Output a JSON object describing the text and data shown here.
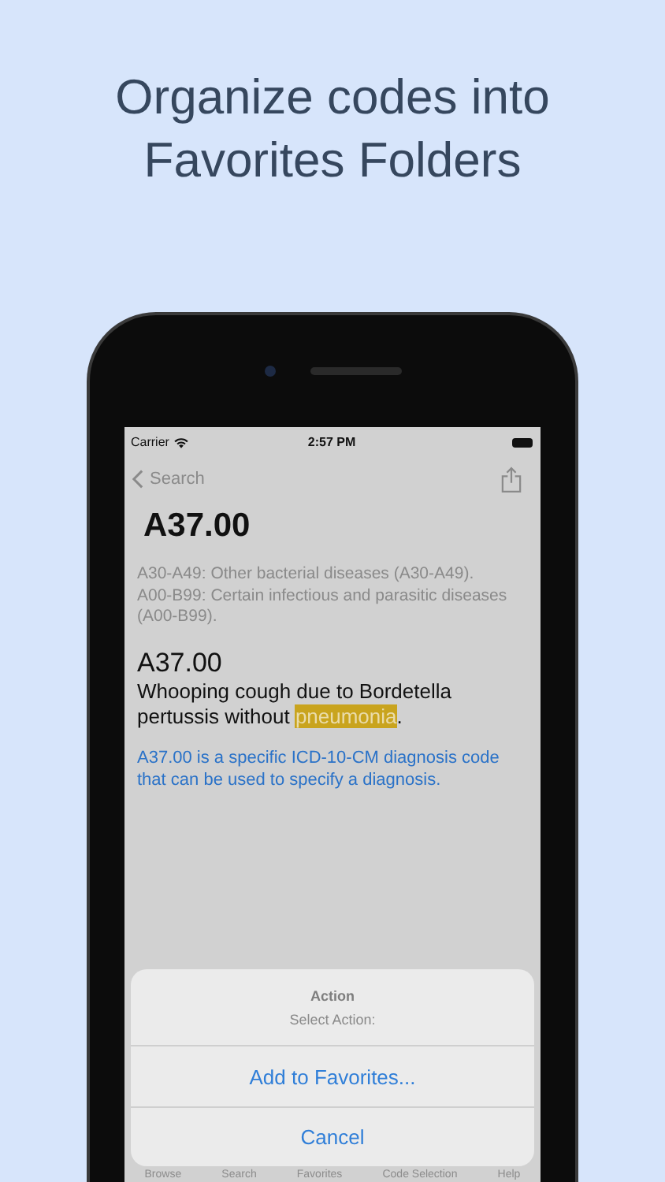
{
  "headline": "Organize codes into Favorites Folders",
  "status_bar": {
    "carrier": "Carrier",
    "time": "2:57 PM"
  },
  "nav_bar": {
    "back_label": "Search"
  },
  "code_title": "A37.00",
  "categories": [
    "A30-A49: Other bacterial diseases (A30-A49).",
    "A00-B99: Certain infectious and parasitic diseases (A00-B99)."
  ],
  "code": "A37.00",
  "description": {
    "before": "Whooping cough due to Bordetella pertussis without ",
    "highlight": "pneumonia",
    "after": "."
  },
  "note": "A37.00 is a specific ICD-10-CM diagnosis code that can be used to specify a diagnosis.",
  "action_sheet": {
    "title": "Action",
    "message": "Select Action:",
    "actions": [
      {
        "label": "Add to Favorites..."
      },
      {
        "label": "Cancel"
      }
    ]
  },
  "tab_bar": [
    "Browse",
    "Search",
    "Favorites",
    "Code Selection",
    "Help"
  ]
}
